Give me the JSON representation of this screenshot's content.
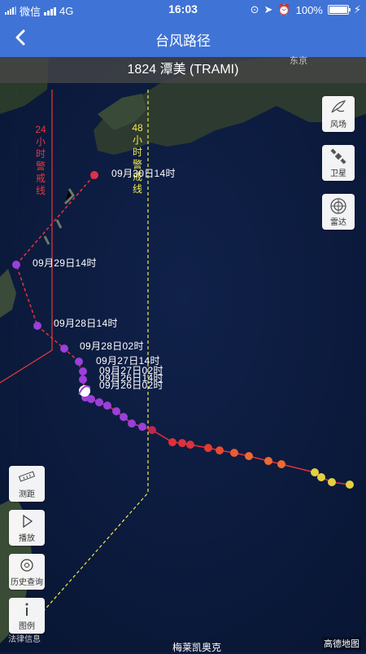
{
  "status": {
    "carrier": "微信",
    "network": "4G",
    "time": "16:03",
    "battery": "100%"
  },
  "nav": {
    "title": "台风路径"
  },
  "typhoon": {
    "name": "1824 潭美 (TRAMI)"
  },
  "warning": {
    "line24": "24小时警戒线",
    "line48": "48小时警戒线"
  },
  "tools_right": [
    {
      "label": "风场",
      "icon": "wind-field-icon"
    },
    {
      "label": "卫星",
      "icon": "satellite-icon"
    },
    {
      "label": "雷达",
      "icon": "radar-icon"
    }
  ],
  "tools_left": [
    {
      "label": "测距",
      "icon": "ruler-icon"
    },
    {
      "label": "播放",
      "icon": "play-icon"
    },
    {
      "label": "历史查询",
      "icon": "history-icon"
    },
    {
      "label": "图例",
      "icon": "info-icon"
    }
  ],
  "track_labels": [
    "09月30日14时",
    "09月29日14时",
    "09月28日14时",
    "09月28日02时",
    "09月27日14时",
    "09月27日02时",
    "09月26日14时",
    "09月26日02时"
  ],
  "map": {
    "city_top": "东京",
    "city_bottom": "梅莱凯奥克",
    "legal": "法律信息",
    "provider": "高德地图"
  },
  "colors": {
    "accent": "#3f73d6",
    "warn24": "#e5393a",
    "warn48": "#f0ec4c",
    "track_purple": "#9b3fd9",
    "track_red": "#e0303c"
  }
}
